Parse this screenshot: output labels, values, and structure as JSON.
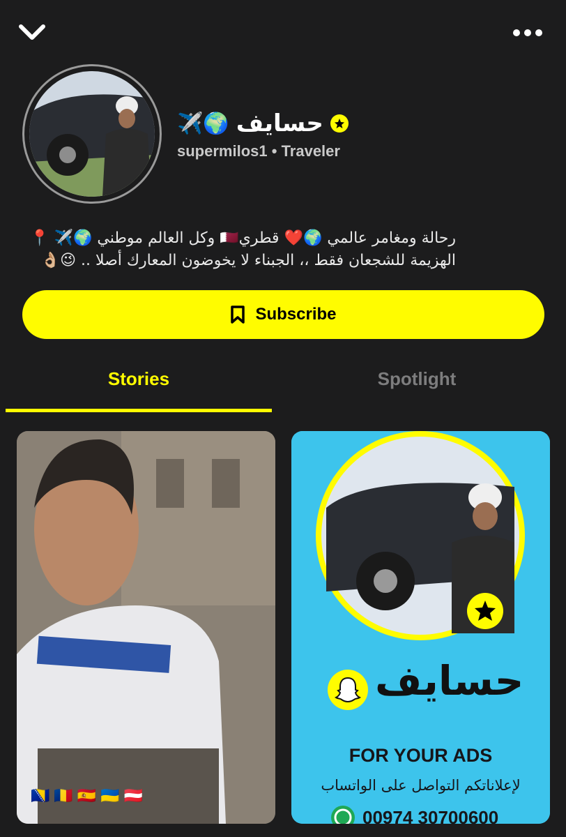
{
  "topbar": {
    "back_icon": "chevron-down-icon",
    "more_icon": "more-dots-icon"
  },
  "profile": {
    "display_name": "حسايف",
    "name_emojis": "✈️🌍",
    "username": "supermilos1",
    "separator": "•",
    "category": "Traveler",
    "verified_icon": "star-badge-icon",
    "bio_line1": "رحالة ومغامر عالمي 🌍❤️ قطري🇶🇦 وكل العالم موطني 🌍✈️ 📍",
    "bio_line2": "الهزيمة للشجعان فقط ،، الجبناء لا يخوضون المعارك أصلا .. 😉👌🏼"
  },
  "subscribe": {
    "label": "Subscribe",
    "icon": "bookmark-icon",
    "color": "#fffc00"
  },
  "tabs": [
    {
      "label": "Stories",
      "active": true
    },
    {
      "label": "Spotlight",
      "active": false
    }
  ],
  "stories": [
    {
      "flags": [
        "🇧🇦",
        "🇷🇴",
        "🇪🇸",
        "🇺🇦",
        "🇦🇹"
      ]
    },
    {
      "title": "حسايف",
      "cta": "FOR YOUR ADS",
      "subtitle": "لإعلاناتكم التواصل على الواتساب",
      "phone": "00974 30700600",
      "phone_icon": "whatsapp-icon",
      "logo_icon": "snapchat-ghost-icon"
    }
  ],
  "colors": {
    "background": "#1c1c1d",
    "accent": "#fffc00",
    "inactive_tab": "#7d7d7e",
    "ad_bg": "#3dc4ec"
  }
}
